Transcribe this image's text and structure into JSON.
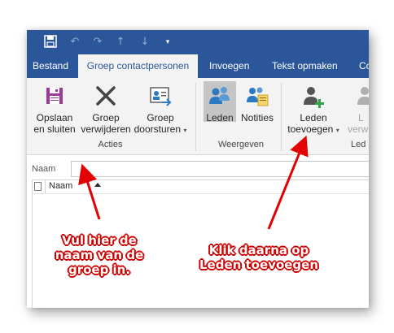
{
  "colors": {
    "ribbon_blue": "#2b579a",
    "ribbon_bg": "#f3f3f3",
    "annotation_red": "#e30000"
  },
  "quick_access": {
    "icons": [
      "save-icon",
      "undo-icon",
      "redo-icon",
      "up-arrow-icon",
      "down-arrow-icon",
      "customize-icon"
    ]
  },
  "tabs": [
    {
      "label": "Bestand"
    },
    {
      "label": "Groep contactpersonen",
      "active": true
    },
    {
      "label": "Invoegen"
    },
    {
      "label": "Tekst opmaken"
    },
    {
      "label": "Co"
    }
  ],
  "ribbon": {
    "acties": {
      "group_label": "Acties",
      "save_close": {
        "line1": "Opslaan",
        "line2": "en sluiten",
        "icon": "save-close-icon"
      },
      "delete_group": {
        "line1": "Groep",
        "line2": "verwijderen",
        "icon": "x-icon"
      },
      "forward_group": {
        "line1": "Groep",
        "line2": "doorsturen",
        "icon": "forward-card-icon"
      }
    },
    "weergeven": {
      "group_label": "Weergeven",
      "leden": {
        "label": "Leden",
        "icon": "people-icon",
        "selected": true
      },
      "notities": {
        "label": "Notities",
        "icon": "notes-card-icon"
      }
    },
    "leden_group": {
      "group_label": "Led",
      "add_members": {
        "line1": "Leden",
        "line2": "toevoegen",
        "icon": "person-add-icon"
      },
      "remove_members": {
        "line1": "L",
        "line2": "verwi",
        "icon": "person-remove-icon"
      }
    }
  },
  "form": {
    "name_label": "Naam",
    "name_value": ""
  },
  "member_list": {
    "column_name": "Naam"
  },
  "annotations": {
    "left": {
      "line1": "Vul hier de",
      "line2": "naam van de",
      "line3": "groep in."
    },
    "right": {
      "line1": "Klik daarna op",
      "line2": "Leden toevoegen"
    }
  }
}
